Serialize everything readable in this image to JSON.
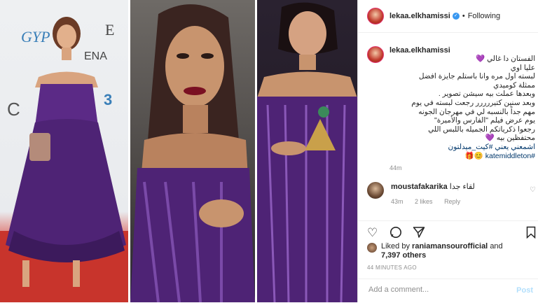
{
  "post": {
    "username": "lekaa.elkhamissi",
    "follow_separator": "•",
    "follow_label": "Following",
    "verified_icon": "✓"
  },
  "caption": {
    "username": "lekaa.elkhamissi",
    "lines": [
      "الفستان دا غالي 💜",
      "عليا اوي",
      "لبسته اول مره وانا باستلم جايزة افضل",
      "ممثلة كوميدي",
      "وبعدها عملت بيه سيشن تصوير .",
      "وبعد سنين كتيررررر رجعت لبسته في يوم",
      "مهم جداً بالنسبه لي في مهرجان الجونه",
      "يوم عرض فيلم \"الفارس والأميرة\"",
      "رجعوا ذكرياتكم الجميله باللبس اللي",
      "محتفظين بيه 💜",
      "اشمعني يعني #كيت_ميدلتون"
    ],
    "last_line": "#katemiddleton 😊🎁",
    "time": "44m"
  },
  "comment": {
    "username": "moustafakarika",
    "text": "لقاء جدا",
    "time": "43m",
    "likes": "2 likes",
    "reply": "Reply"
  },
  "actions": {
    "like_icon": "heart-icon",
    "comment_icon": "comment-icon",
    "share_icon": "share-icon"
  },
  "likes": {
    "prefix": "Liked by",
    "user": "raniamansourofficial",
    "and": "and",
    "others": "7,397 others"
  },
  "time_ago": "44 MINUTES AGO",
  "add_comment": {
    "placeholder": "Add a comment...",
    "post_label": "Post"
  },
  "colors": {
    "dress": "#5b2a86",
    "verified": "#3897f0",
    "link": "#00376b"
  }
}
